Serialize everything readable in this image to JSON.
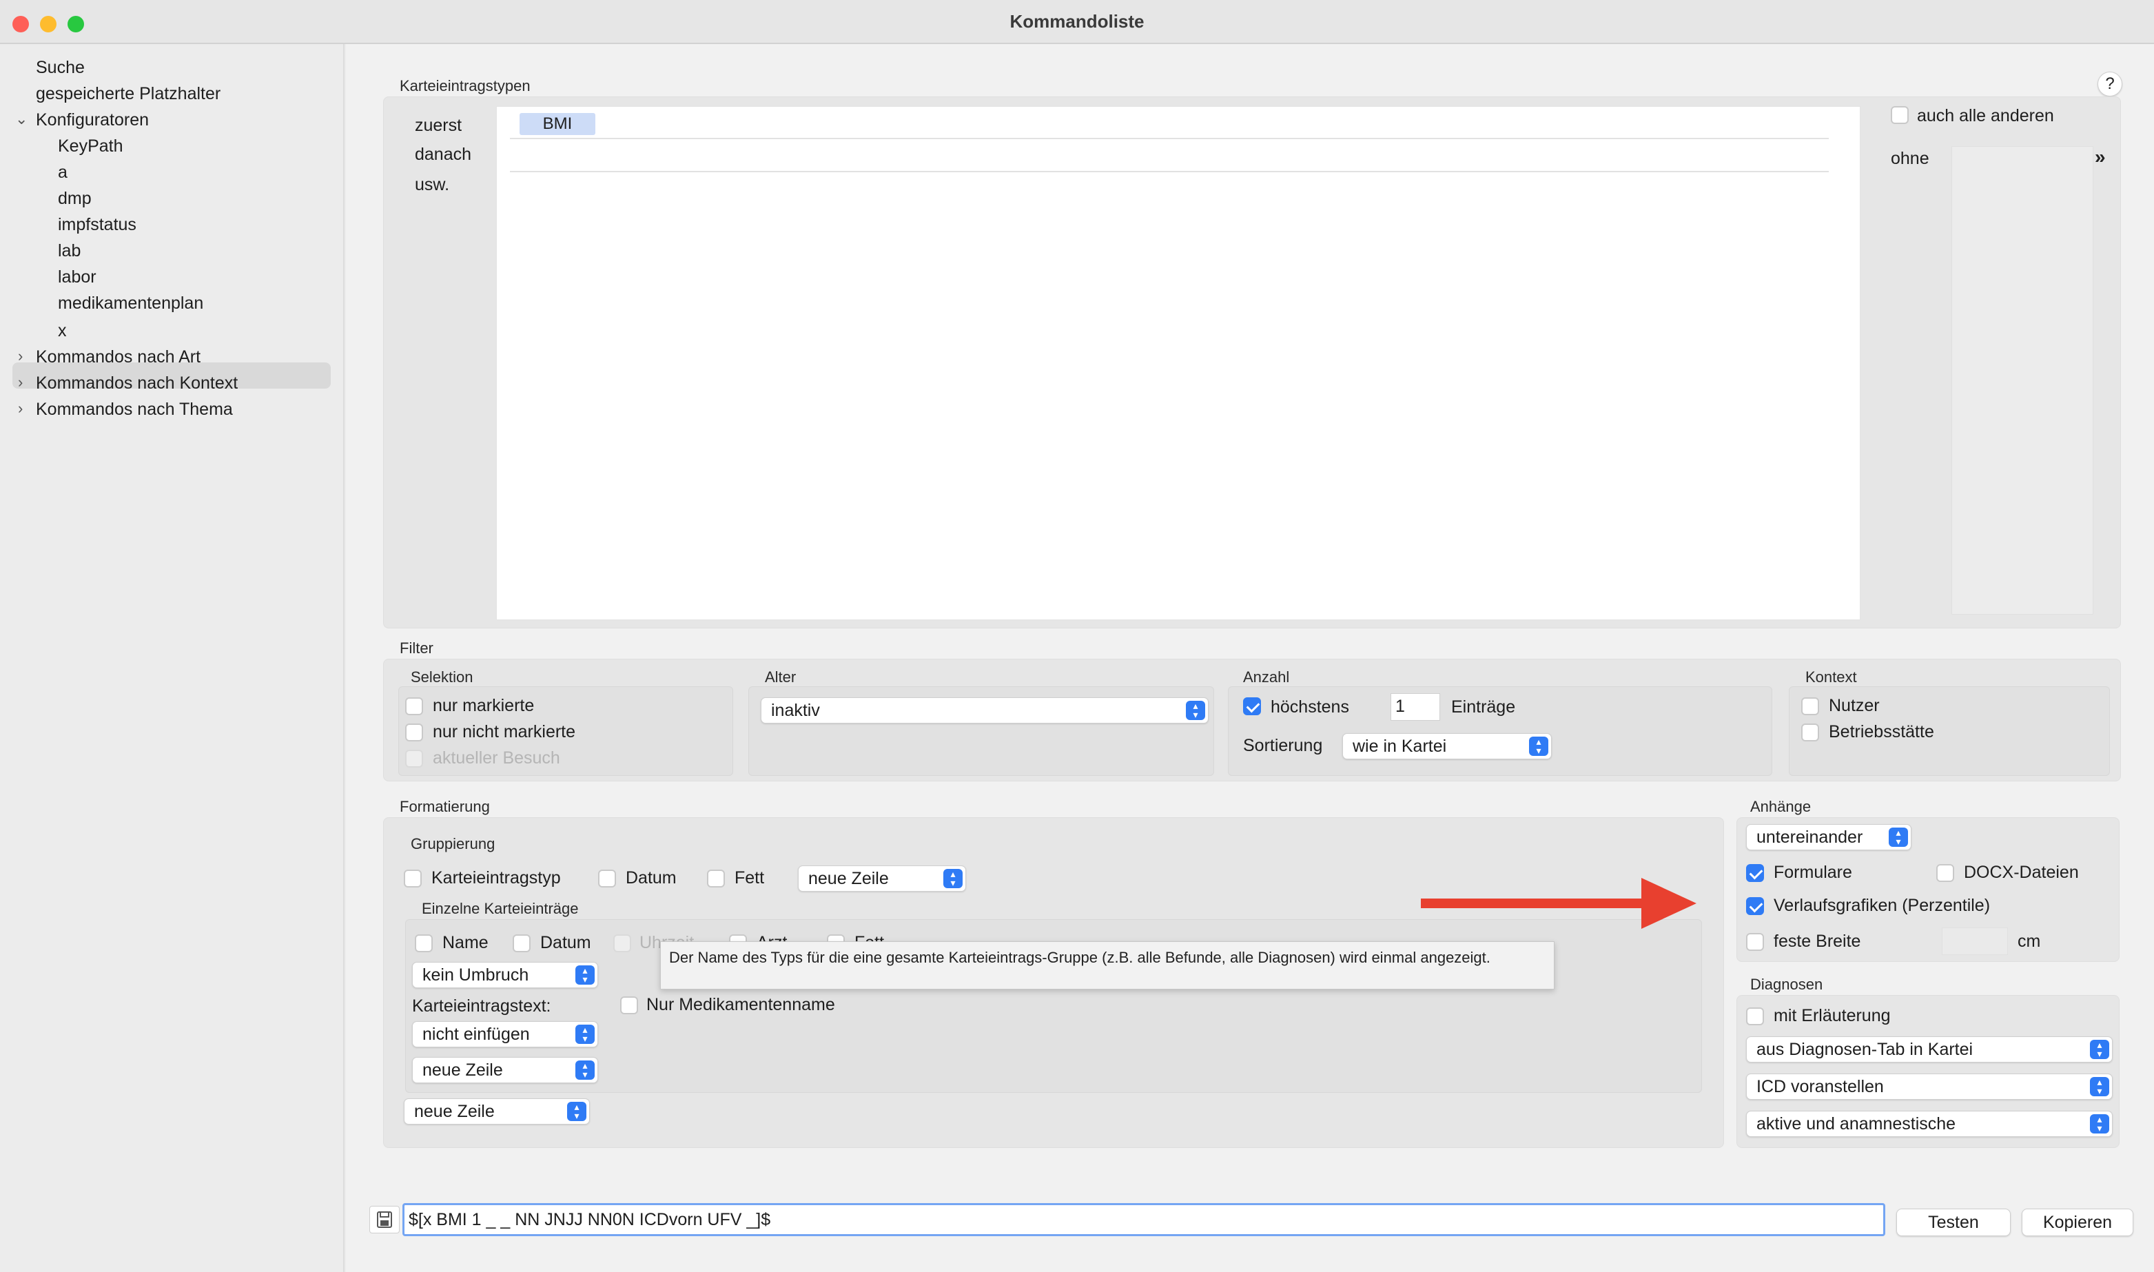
{
  "window": {
    "title": "Kommandoliste"
  },
  "sidebar": {
    "items": [
      {
        "label": "Suche"
      },
      {
        "label": "gespeicherte Platzhalter"
      },
      {
        "label": "Konfiguratoren"
      },
      {
        "label": "KeyPath"
      },
      {
        "label": "a"
      },
      {
        "label": "dmp"
      },
      {
        "label": "impfstatus"
      },
      {
        "label": "lab"
      },
      {
        "label": "labor"
      },
      {
        "label": "medikamentenplan"
      },
      {
        "label": "x"
      },
      {
        "label": "Kommandos nach Art"
      },
      {
        "label": "Kommandos nach Kontext"
      },
      {
        "label": "Kommandos nach Thema"
      }
    ]
  },
  "help_label": "?",
  "types": {
    "section_label": "Karteieintragstypen",
    "row_labels": [
      "zuerst",
      "danach",
      "usw."
    ],
    "selected_token": "BMI",
    "others_label": "auch alle anderen",
    "without_label": "ohne"
  },
  "filter": {
    "section_label": "Filter",
    "selection": {
      "label": "Selektion",
      "options": [
        "nur markierte",
        "nur nicht markierte",
        "aktueller Besuch"
      ]
    },
    "age": {
      "label": "Alter",
      "value": "inaktiv"
    },
    "count": {
      "label": "Anzahl",
      "max_label": "höchstens",
      "max_value": "1",
      "entries_label": "Einträge",
      "sort_label": "Sortierung",
      "sort_value": "wie in Kartei"
    },
    "context": {
      "label": "Kontext",
      "options": [
        "Nutzer",
        "Betriebsstätte"
      ]
    }
  },
  "formatting": {
    "section_label": "Formatierung",
    "grouping": {
      "label": "Gruppierung",
      "type_label": "Karteieintragstyp",
      "date_label": "Datum",
      "bold_label": "Fett",
      "break_value": "neue Zeile"
    },
    "single": {
      "label": "Einzelne Karteieinträge",
      "name_label": "Name",
      "date_label": "Datum",
      "time_label": "Uhrzeit",
      "doctor_label": "Arzt",
      "bold_label": "Fett",
      "wrap_value": "kein Umbruch",
      "text_label": "Karteieintragstext:",
      "only_drug_label": "Nur Medikamentenname",
      "insert_value": "nicht einfügen",
      "line_value": "neue Zeile"
    },
    "outer_line_value": "neue Zeile"
  },
  "tooltip": "Der Name des Typs für die eine gesamte Karteieintrags-Gruppe (z.B. alle Befunde, alle Diagnosen) wird einmal angezeigt.",
  "attachments": {
    "section_label": "Anhänge",
    "layout_value": "untereinander",
    "forms_label": "Formulare",
    "docx_label": "DOCX-Dateien",
    "charts_label": "Verlaufsgrafiken (Perzentile)",
    "fixed_width_label": "feste Breite",
    "unit_label": "cm"
  },
  "diagnoses": {
    "section_label": "Diagnosen",
    "explain_label": "mit Erläuterung",
    "source_value": "aus Diagnosen-Tab in Kartei",
    "icd_value": "ICD voranstellen",
    "scope_value": "aktive und anamnestische"
  },
  "command": {
    "value": "$[x BMI 1 _ _ NN JNJJ NN0N ICDvorn UFV _]$",
    "test_label": "Testen",
    "copy_label": "Kopieren"
  },
  "colors": {
    "accent": "#2f7bf5",
    "arrow": "#e8402f",
    "selection": "#cddcf7"
  }
}
